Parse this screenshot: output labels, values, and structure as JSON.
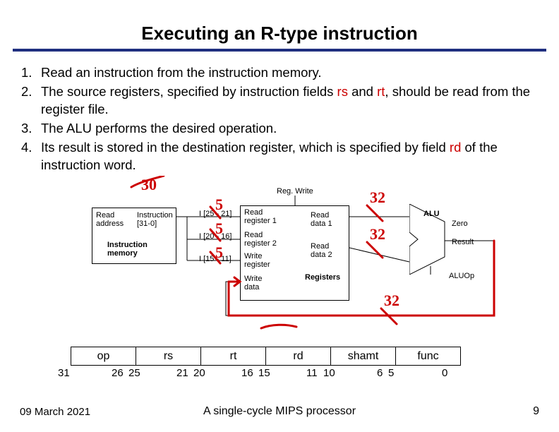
{
  "title": "Executing an R-type instruction",
  "steps": [
    {
      "num": "1.",
      "parts": [
        {
          "t": "Read an instruction from the instruction memory."
        }
      ]
    },
    {
      "num": "2.",
      "parts": [
        {
          "t": "The source registers, specified by instruction fields "
        },
        {
          "t": "rs",
          "c": "red"
        },
        {
          "t": " and "
        },
        {
          "t": "rt",
          "c": "red"
        },
        {
          "t": ", should be read from the register file."
        }
      ]
    },
    {
      "num": "3.",
      "parts": [
        {
          "t": "The ALU performs the desired operation."
        }
      ]
    },
    {
      "num": "4.",
      "parts": [
        {
          "t": "Its result is stored in the destination register, which is specified by field "
        },
        {
          "t": "rd",
          "c": "red"
        },
        {
          "t": " of the instruction word."
        }
      ]
    }
  ],
  "diagram_labels": {
    "regwrite": "Reg. Write",
    "read_address": "Read\naddress",
    "instruction_bus": "Instruction\n[31-0]",
    "instruction_memory": "Instruction\nmemory",
    "i25_21": "I [25 - 21]",
    "i20_16": "I [20 - 16]",
    "i15_11": "I [15 - 11]",
    "read_reg1": "Read\nregister 1",
    "read_reg2": "Read\nregister 2",
    "write_reg": "Write\nregister",
    "write_data": "Write\ndata",
    "read_data1": "Read\ndata 1",
    "read_data2": "Read\ndata 2",
    "registers": "Registers",
    "alu": "ALU",
    "zero": "Zero",
    "result": "Result",
    "aluop": "ALUOp"
  },
  "annotations": {
    "thirty": "30",
    "five_a": "5",
    "five_b": "5",
    "five_c": "5",
    "thirtytwo_a": "32",
    "thirtytwo_b": "32",
    "thirtytwo_c": "32"
  },
  "fields": {
    "headers": [
      "op",
      "rs",
      "rt",
      "rd",
      "shamt",
      "func"
    ],
    "bits": [
      "31",
      "26",
      "25",
      "21",
      "20",
      "16",
      "15",
      "11",
      "10",
      "6",
      "5",
      "0"
    ]
  },
  "footer": {
    "date": "09 March 2021",
    "center": "A single-cycle MIPS processor",
    "page": "9"
  }
}
